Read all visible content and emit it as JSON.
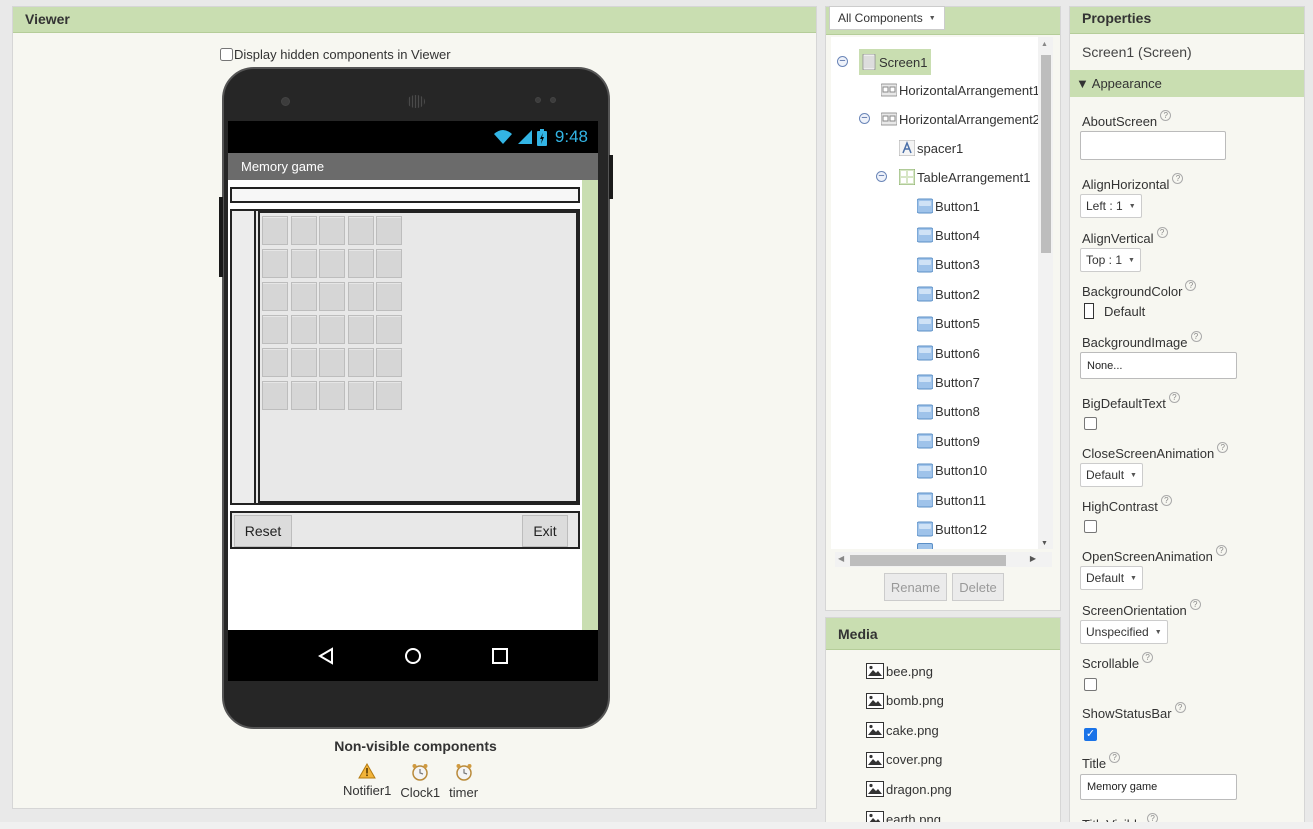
{
  "viewer": {
    "title": "Viewer",
    "hidden_components_label": "Display hidden components in Viewer",
    "phone": {
      "time": "9:48",
      "app_title": "Memory game",
      "reset_label": "Reset",
      "exit_label": "Exit"
    },
    "nonvisible_title": "Non-visible components",
    "nonvisible": [
      {
        "name": "Notifier1",
        "icon": "warning-icon"
      },
      {
        "name": "Clock1",
        "icon": "clock-icon"
      },
      {
        "name": "timer",
        "icon": "clock-icon"
      }
    ]
  },
  "components": {
    "dropdown_label": "All Components",
    "tree": [
      {
        "label": "Screen1",
        "icon": "screen-icon"
      },
      {
        "label": "HorizontalArrangement1",
        "icon": "arrangement-icon"
      },
      {
        "label": "HorizontalArrangement2",
        "icon": "arrangement-icon"
      },
      {
        "label": "spacer1",
        "icon": "label-icon"
      },
      {
        "label": "TableArrangement1",
        "icon": "table-icon"
      },
      {
        "label": "Button1",
        "icon": "button-icon"
      },
      {
        "label": "Button4",
        "icon": "button-icon"
      },
      {
        "label": "Button3",
        "icon": "button-icon"
      },
      {
        "label": "Button2",
        "icon": "button-icon"
      },
      {
        "label": "Button5",
        "icon": "button-icon"
      },
      {
        "label": "Button6",
        "icon": "button-icon"
      },
      {
        "label": "Button7",
        "icon": "button-icon"
      },
      {
        "label": "Button8",
        "icon": "button-icon"
      },
      {
        "label": "Button9",
        "icon": "button-icon"
      },
      {
        "label": "Button10",
        "icon": "button-icon"
      },
      {
        "label": "Button11",
        "icon": "button-icon"
      },
      {
        "label": "Button12",
        "icon": "button-icon"
      }
    ],
    "rename_label": "Rename",
    "delete_label": "Delete"
  },
  "media": {
    "title": "Media",
    "files": [
      "bee.png",
      "bomb.png",
      "cake.png",
      "cover.png",
      "dragon.png",
      "earth.png"
    ]
  },
  "properties": {
    "title": "Properties",
    "subtitle": "Screen1 (Screen)",
    "section": "Appearance",
    "about_screen": {
      "label": "AboutScreen",
      "value": ""
    },
    "align_horizontal": {
      "label": "AlignHorizontal",
      "value": "Left : 1"
    },
    "align_vertical": {
      "label": "AlignVertical",
      "value": "Top : 1"
    },
    "background_color": {
      "label": "BackgroundColor",
      "value": "Default"
    },
    "background_image": {
      "label": "BackgroundImage",
      "value": "None..."
    },
    "big_default_text": {
      "label": "BigDefaultText",
      "checked": false
    },
    "close_screen_animation": {
      "label": "CloseScreenAnimation",
      "value": "Default"
    },
    "high_contrast": {
      "label": "HighContrast",
      "checked": false
    },
    "open_screen_animation": {
      "label": "OpenScreenAnimation",
      "value": "Default"
    },
    "screen_orientation": {
      "label": "ScreenOrientation",
      "value": "Unspecified"
    },
    "scrollable": {
      "label": "Scrollable",
      "checked": false
    },
    "show_status_bar": {
      "label": "ShowStatusBar",
      "checked": true
    },
    "title_prop": {
      "label": "Title",
      "value": "Memory game"
    },
    "title_visible": {
      "label": "TitleVisible"
    }
  },
  "colors": {
    "panel_header": "#c9deb1",
    "status_accent": "#33b5e5",
    "checkbox_on": "#1a73e8"
  }
}
